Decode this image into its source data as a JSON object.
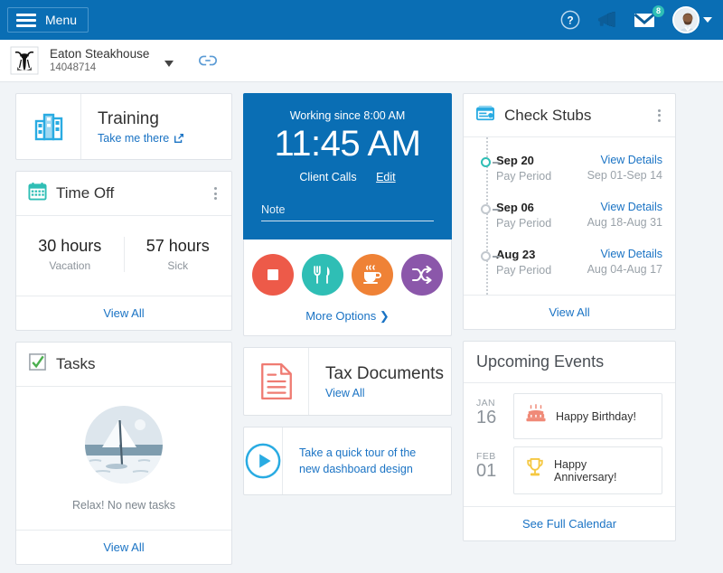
{
  "colors": {
    "brand_blue": "#0a6eb4",
    "link_blue": "#1a73c4",
    "teal": "#2fbeb5",
    "page_bg": "#f1f4f7",
    "stop_red": "#ed5a49",
    "meal_teal": "#2fbeb5",
    "break_orange": "#ef8236",
    "transfer_purple": "#8b57aa",
    "task_green": "#4caf50",
    "tax_red": "#ef7b72",
    "birthday_orange": "#f08a78",
    "anniversary_gold": "#f5c842"
  },
  "topbar": {
    "menu_label": "Menu",
    "help_icon": "help-circle-icon",
    "announcement_icon": "megaphone-icon",
    "mail_icon": "envelope-icon",
    "mail_badge": "8",
    "avatar_icon": "user-avatar",
    "caret_icon": "chevron-down-icon"
  },
  "company": {
    "logo_icon": "steer-logo",
    "name": "Eaton Steakhouse",
    "id": "14048714",
    "switch_icon": "chevron-down-icon",
    "link_icon": "link-chain-icon"
  },
  "training": {
    "icon": "building-chart-icon",
    "title": "Training",
    "link": "Take me there",
    "external_icon": "external-link-icon"
  },
  "time_off": {
    "icon": "calendar-icon",
    "title": "Time Off",
    "menu_icon": "kebab-menu-icon",
    "stats": [
      {
        "value": "30 hours",
        "label": "Vacation"
      },
      {
        "value": "57 hours",
        "label": "Sick"
      }
    ],
    "view_all": "View All"
  },
  "tasks": {
    "icon": "checkbox-checked-icon",
    "title": "Tasks",
    "illustration": "sailboat-illustration",
    "empty_message": "Relax! No new tasks",
    "view_all": "View All"
  },
  "clock": {
    "working_since": "Working since 8:00 AM",
    "current_time": "11:45 AM",
    "department": "Client Calls",
    "edit_label": "Edit",
    "note_placeholder": "Note",
    "actions": [
      {
        "name": "stop-button",
        "icon": "stop-square-icon",
        "color": "#ed5a49"
      },
      {
        "name": "meal-button",
        "icon": "fork-knife-icon",
        "color": "#2fbeb5"
      },
      {
        "name": "break-button",
        "icon": "coffee-cup-icon",
        "color": "#ef8236"
      },
      {
        "name": "transfer-button",
        "icon": "shuffle-arrows-icon",
        "color": "#8b57aa"
      }
    ],
    "more_options": "More Options",
    "more_icon": "chevron-right-icon"
  },
  "tax_documents": {
    "icon": "document-lines-icon",
    "title": "Tax Documents",
    "link": "View All"
  },
  "tour": {
    "icon": "play-circle-icon",
    "text": "Take a quick tour of the new dashboard design"
  },
  "check_stubs": {
    "icon": "paycheck-icon",
    "title": "Check Stubs",
    "menu_icon": "kebab-menu-icon",
    "period_label": "Pay Period",
    "details_label": "View Details",
    "items": [
      {
        "date": "Sep 20",
        "period": "Pay Period",
        "range": "Sep 01-Sep 14",
        "link": "View Details",
        "active": true
      },
      {
        "date": "Sep 06",
        "period": "Pay Period",
        "range": "Aug 18-Aug 31",
        "link": "View Details",
        "active": false
      },
      {
        "date": "Aug 23",
        "period": "Pay Period",
        "range": "Aug 04-Aug 17",
        "link": "View Details",
        "active": false
      }
    ],
    "view_all": "View All"
  },
  "upcoming_events": {
    "title": "Upcoming Events",
    "events": [
      {
        "month": "JAN",
        "day": "16",
        "label": "Happy Birthday!",
        "icon": "birthday-cake-icon"
      },
      {
        "month": "FEB",
        "day": "01",
        "label": "Happy Anniversary!",
        "icon": "trophy-icon"
      }
    ],
    "see_calendar": "See Full Calendar"
  }
}
